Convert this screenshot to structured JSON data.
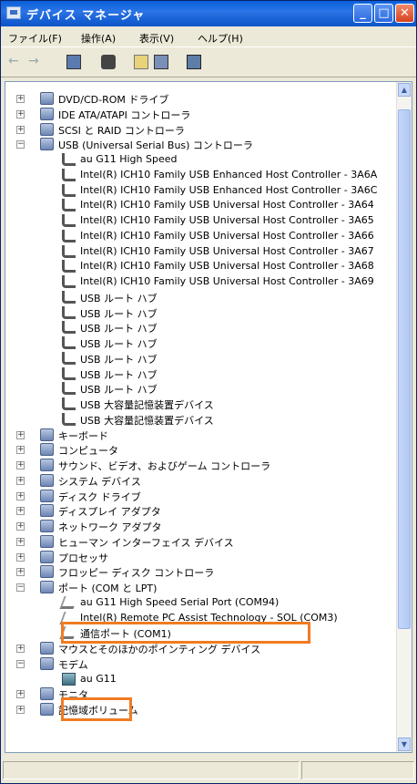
{
  "window": {
    "title": "デバイス マネージャ"
  },
  "menu": {
    "items": [
      "ファイル(F)",
      "操作(A)",
      "表示(V)",
      "ヘルプ(H)"
    ]
  },
  "tree": {
    "top_categories": [
      "DVD/CD-ROM ドライブ",
      "IDE ATA/ATAPI コントローラ",
      "SCSI と RAID コントローラ",
      "USB (Universal Serial Bus) コントローラ"
    ],
    "usb_children": [
      "au G11 High Speed",
      "Intel(R) ICH10 Family USB Enhanced Host Controller - 3A6A",
      "Intel(R) ICH10 Family USB Enhanced Host Controller - 3A6C",
      "Intel(R) ICH10 Family USB Universal Host Controller - 3A64",
      "Intel(R) ICH10 Family USB Universal Host Controller - 3A65",
      "Intel(R) ICH10 Family USB Universal Host Controller - 3A66",
      "Intel(R) ICH10 Family USB Universal Host Controller - 3A67",
      "Intel(R) ICH10 Family USB Universal Host Controller - 3A68",
      "Intel(R) ICH10 Family USB Universal Host Controller - 3A69",
      "USB ルート ハブ",
      "USB ルート ハブ",
      "USB ルート ハブ",
      "USB ルート ハブ",
      "USB ルート ハブ",
      "USB ルート ハブ",
      "USB ルート ハブ",
      "USB 大容量記憶装置デバイス",
      "USB 大容量記憶装置デバイス"
    ],
    "mid_categories": [
      "キーボード",
      "コンピュータ",
      "サウンド、ビデオ、およびゲーム コントローラ",
      "システム デバイス",
      "ディスク ドライブ",
      "ディスプレイ アダプタ",
      "ネットワーク アダプタ",
      "ヒューマン インターフェイス デバイス",
      "プロセッサ",
      "フロッピー ディスク コントローラ",
      "ポート (COM と LPT)"
    ],
    "port_children": [
      "au G11 High Speed Serial Port (COM94)",
      "Intel(R) Remote PC Assist Technology - SOL (COM3)",
      "通信ポート (COM1)"
    ],
    "after_ports": [
      "マウスとそのほかのポインティング デバイス",
      "モデム"
    ],
    "modem_children": [
      "au G11"
    ],
    "bottom_categories": [
      "モニタ",
      "記憶域ボリューム"
    ]
  },
  "highlight_color": "#f07b21"
}
